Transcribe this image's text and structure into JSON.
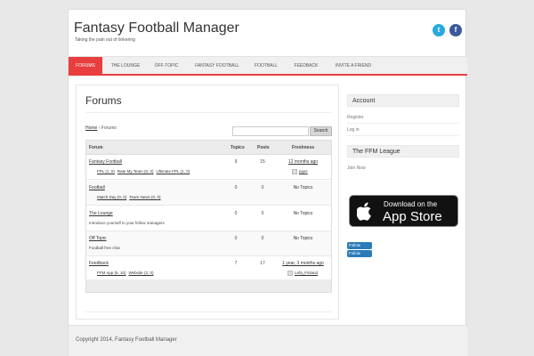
{
  "site": {
    "title": "Fantasy Football Manager",
    "tagline": "Taking the pain out of tinkering",
    "twitter_glyph": "t",
    "facebook_glyph": "f"
  },
  "nav": [
    "FORUMS",
    "THE LOUNGE",
    "OFF-TOPIC",
    "FANTASY FOOTBALL",
    "FOOTBALL",
    "FEEDBACK",
    "INVITE A FRIEND"
  ],
  "colors": {
    "accent": "#e83e3e",
    "twitter": "#29a9df",
    "facebook": "#3b5998"
  },
  "page": {
    "title": "Forums",
    "breadcrumb_home": "Home",
    "breadcrumb_sep": "›",
    "breadcrumb_current": "Forums",
    "search_label": "Search"
  },
  "table": {
    "headers": [
      "Forum",
      "Topics",
      "Posts",
      "Freshness"
    ],
    "rows": [
      {
        "name": "Fantasy Football",
        "subs": [
          "FPL (1, 0)",
          "Rate My Team (6, 0)",
          "Ultimate FPL (1, 0)"
        ],
        "topics": "9",
        "posts": "15",
        "freshness": "12 months ago",
        "by": "pgaz"
      },
      {
        "name": "Football",
        "subs": [
          "Match Day (0, 0)",
          "Team News (0, 0)"
        ],
        "topics": "0",
        "posts": "0",
        "freshness": "No Topics"
      },
      {
        "name": "The Lounge",
        "desc": "Introduce yourself to your fellow managers",
        "topics": "0",
        "posts": "0",
        "freshness": "No Topics"
      },
      {
        "name": "Off Topic",
        "desc": "Football free chat",
        "topics": "0",
        "posts": "0",
        "freshness": "No Topics"
      },
      {
        "name": "Feedback",
        "subs": [
          "FFM App (5, 10)",
          "Website (2, 0)"
        ],
        "topics": "7",
        "posts": "17",
        "freshness": "1 year, 3 months ago",
        "by": "Lefa_Finland"
      }
    ]
  },
  "sidebar": {
    "account_title": "Account",
    "register": "Register",
    "login": "Log in",
    "league_title": "The FFM League",
    "join": "Join Now",
    "appstore_small": "Download on the",
    "appstore_big": "App Store",
    "follow": "Follow",
    "apple_icon": "apple-icon"
  },
  "footer": {
    "copyright": "Copyright 2014, Fantasy Football Manager"
  }
}
